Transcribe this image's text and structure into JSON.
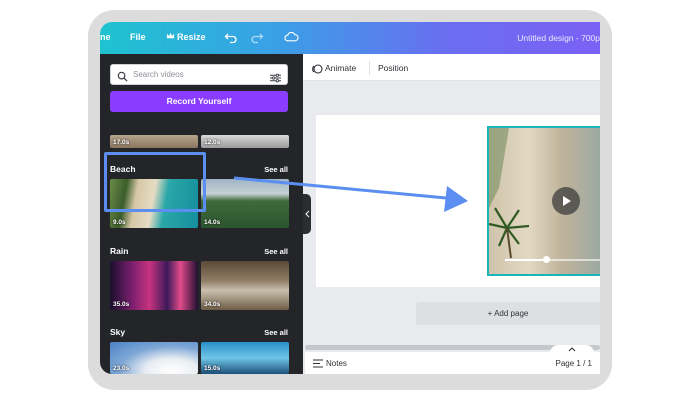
{
  "topbar": {
    "partial_item": "ne",
    "file": "File",
    "resize": "Resize",
    "title": "Untitled design - 700p",
    "icons": [
      "crown-icon",
      "undo-icon",
      "redo-icon",
      "cloud-icon"
    ]
  },
  "panel": {
    "search_placeholder": "Search videos",
    "record_button": "Record Yourself",
    "top_row_durations": [
      "17.0s",
      "12.0s"
    ],
    "sections": [
      {
        "label": "Beach",
        "see_all": "See all",
        "durations": [
          "9.0s",
          "14.0s"
        ]
      },
      {
        "label": "Rain",
        "see_all": "See all",
        "durations": [
          "35.0s",
          "34.0s"
        ]
      },
      {
        "label": "Sky",
        "see_all": "See all",
        "durations": [
          "23.0s",
          "15.0s"
        ]
      }
    ]
  },
  "toolbar": {
    "animate": "Animate",
    "position": "Position"
  },
  "canvas": {
    "add_page": "+ Add page",
    "video_progress": 0.44
  },
  "bottom": {
    "notes": "Notes",
    "pager": "Page 1 / 1"
  },
  "colors": {
    "accent_purple": "#8b3dff",
    "panel_bg": "#232529",
    "highlight": "#5b8ef0",
    "selection": "#1bb4b8"
  }
}
